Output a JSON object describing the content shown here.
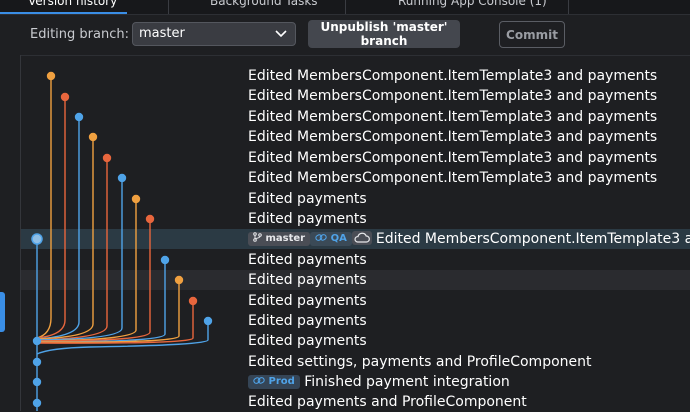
{
  "top_tabs": [
    "Version history",
    "Background Tasks",
    "Running App Console (1)"
  ],
  "toolbar": {
    "editing_label": "Editing branch:",
    "branch_value": "master",
    "unpublish_label": "Unpublish 'master' branch",
    "commit_label": "Commit"
  },
  "commits": [
    {
      "message": "Edited MembersComponent.ItemTemplate3 and payments"
    },
    {
      "message": "Edited MembersComponent.ItemTemplate3 and payments"
    },
    {
      "message": "Edited MembersComponent.ItemTemplate3 and payments"
    },
    {
      "message": "Edited MembersComponent.ItemTemplate3 and payments"
    },
    {
      "message": "Edited MembersComponent.ItemTemplate3 and payments"
    },
    {
      "message": "Edited MembersComponent.ItemTemplate3 and payments"
    },
    {
      "message": "Edited payments"
    },
    {
      "message": "Edited payments"
    },
    {
      "message": "Edited MembersComponent.ItemTemplate3 a",
      "branch_badge": "master",
      "env_badge": "QA",
      "cloud_icon": "cloud-icon",
      "selected": true
    },
    {
      "message": "Edited payments"
    },
    {
      "message": "Edited payments",
      "hover": true
    },
    {
      "message": "Edited payments"
    },
    {
      "message": "Edited payments"
    },
    {
      "message": "Edited payments"
    },
    {
      "message": "Edited settings, payments and ProfileComponent"
    },
    {
      "message": "Finished payment integration",
      "env_badge": "Prod"
    },
    {
      "message": "Edited payments and ProfileComponent"
    }
  ],
  "colors": {
    "blue": "#4fa3e8",
    "orange": "#f0a040",
    "red_orange": "#e8663d",
    "selected_row": "#2b3a44"
  }
}
